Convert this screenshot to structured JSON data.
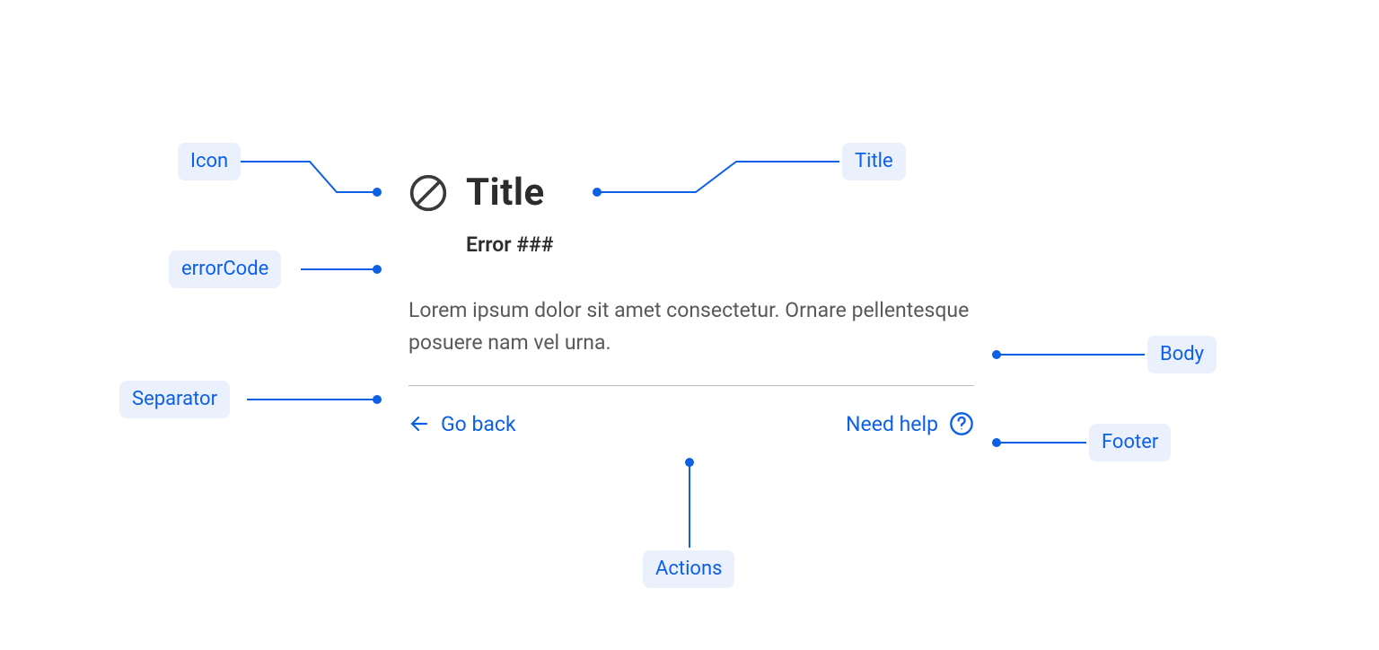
{
  "annotations": {
    "icon": "Icon",
    "errorCode": "errorCode",
    "separator": "Separator",
    "title": "Title",
    "body": "Body",
    "footer": "Footer",
    "actions": "Actions"
  },
  "component": {
    "title": "Title",
    "errorCode": "Error ###",
    "body": "Lorem ipsum dolor sit amet consectetur. Ornare pellentesque posuere nam vel urna.",
    "actions": {
      "back": "Go back",
      "help": "Need help"
    }
  }
}
